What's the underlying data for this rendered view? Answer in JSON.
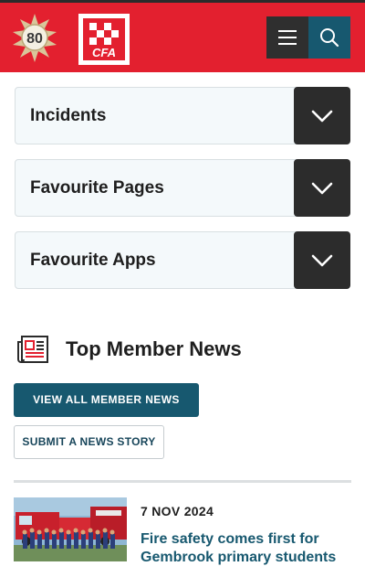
{
  "header": {
    "badge_text": "80",
    "logo_text": "CFA",
    "colors": {
      "header_bg": "#e3202f",
      "menu_bg": "#2f2f2f",
      "search_bg": "#17586f"
    }
  },
  "accordions": [
    {
      "label": "Incidents"
    },
    {
      "label": "Favourite Pages"
    },
    {
      "label": "Favourite Apps"
    }
  ],
  "member_news": {
    "title": "Top Member News",
    "view_all_label": "VIEW ALL MEMBER NEWS",
    "submit_label": "SUBMIT A NEWS STORY",
    "items": [
      {
        "date": "7 NOV 2024",
        "title": "Fire safety comes first for Gembrook primary students"
      }
    ]
  },
  "icons": [
    "cfa-80-years-badge",
    "cfa-logo",
    "menu-icon",
    "search-icon",
    "chevron-down-icon",
    "newspaper-icon"
  ]
}
